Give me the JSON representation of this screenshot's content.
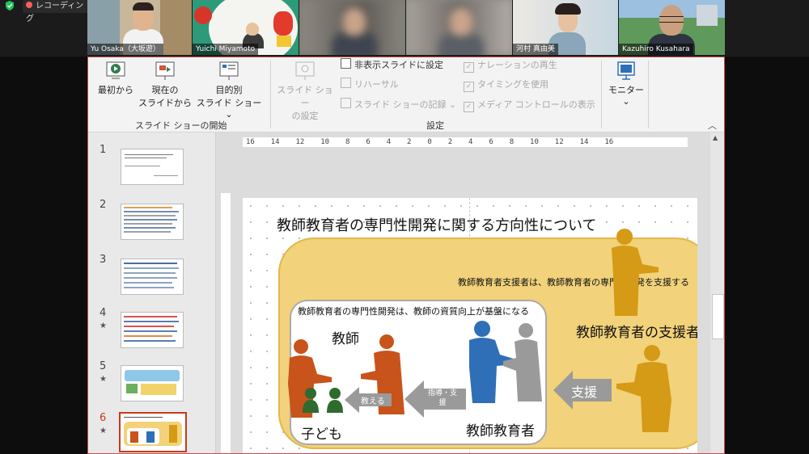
{
  "zoom": {
    "app_label": "レコーディング",
    "status_color": "#22c55e"
  },
  "participants": [
    {
      "name": "Yu Osaka（大坂遊）",
      "bg": "#c9b79a"
    },
    {
      "name": "Yuichi Miyamoto",
      "bg": "#2d9a7a"
    },
    {
      "name": "",
      "bg": "#7a7670"
    },
    {
      "name": "",
      "bg": "#8d8a86"
    },
    {
      "name": "河村 真由美",
      "bg": "#d9e4ea"
    },
    {
      "name": "Kazuhiro Kusahara",
      "bg": "#5b8f5a"
    }
  ],
  "ribbon": {
    "btn_from_start": "最初から",
    "btn_from_current_1": "現在の",
    "btn_from_current_2": "スライドから",
    "btn_custom_1": "目的別",
    "btn_custom_2": "スライド ショー",
    "group_start": "スライド ショーの開始",
    "btn_setup_1": "スライド ショー",
    "btn_setup_2": "の設定",
    "hide_slide": "非表示スライドに設定",
    "rehearse": "リハーサル",
    "record": "スライド ショーの記録",
    "play_narration": "ナレーションの再生",
    "use_timings": "タイミングを使用",
    "show_media": "メディア コントロールの表示",
    "group_setup": "設定",
    "monitor": "モニター"
  },
  "ruler_labels": "16 14 12 10 8 6 4 2 0 2 4 6 8 10 12 14 16",
  "thumbs": [
    {
      "num": "1",
      "star": ""
    },
    {
      "num": "2",
      "star": ""
    },
    {
      "num": "3",
      "star": ""
    },
    {
      "num": "4",
      "star": "★"
    },
    {
      "num": "5",
      "star": "★"
    },
    {
      "num": "6",
      "star": "★"
    }
  ],
  "slide": {
    "title": "教師教育者の専門性開発に関する方向性について",
    "support_note": "教師教育者支援者は、教師教育者の専門性開発を支援する",
    "inner_note": "教師教育者の専門性開発は、教師の資質向上が基盤になる",
    "teacher": "教師",
    "children": "子ども",
    "teacher_educator": "教師教育者",
    "supporter": "教師教育者の支援者",
    "arrow_teach": "教える",
    "arrow_guide": "指導・支援",
    "arrow_support": "支援",
    "colors": {
      "gold": "#f2d27a",
      "gold_border": "#e0b84a",
      "gold_fig": "#d59a16",
      "orange_fig": "#c8531b",
      "blue_fig": "#2f6fb7",
      "green_fig": "#2e6b2e"
    }
  }
}
